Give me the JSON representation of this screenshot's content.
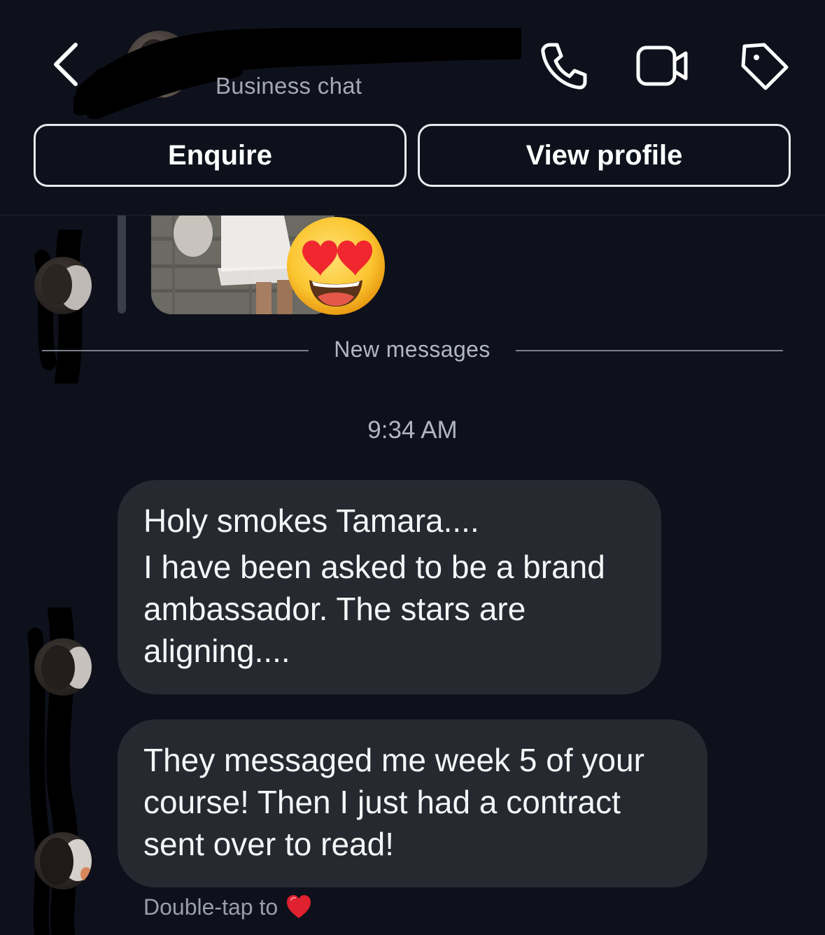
{
  "header": {
    "back_icon": "chevron-left-icon",
    "title": "",
    "subtitle": "Business chat",
    "icons": [
      "phone-icon",
      "video-camera-icon",
      "tag-icon"
    ],
    "buttons": {
      "enquire": "Enquire",
      "view_profile": "View profile"
    }
  },
  "chat": {
    "divider_label": "New messages",
    "timestamp": "9:34 AM",
    "messages": [
      {
        "lines": [
          "Holy smokes Tamara....",
          "I have been asked to be a brand ambassador. The stars are aligning...."
        ]
      },
      {
        "lines": [
          "They messaged me week 5 of your course! Then I just had a contract sent over to read!"
        ]
      }
    ],
    "reaction_hint": "Double-tap to",
    "reaction_icon": "heart-icon"
  },
  "colors": {
    "background": "#0e111b",
    "bubble": "#262930",
    "button_border": "#e9eaee",
    "muted_text": "#b2b6c0",
    "heart": "#e0212f"
  }
}
